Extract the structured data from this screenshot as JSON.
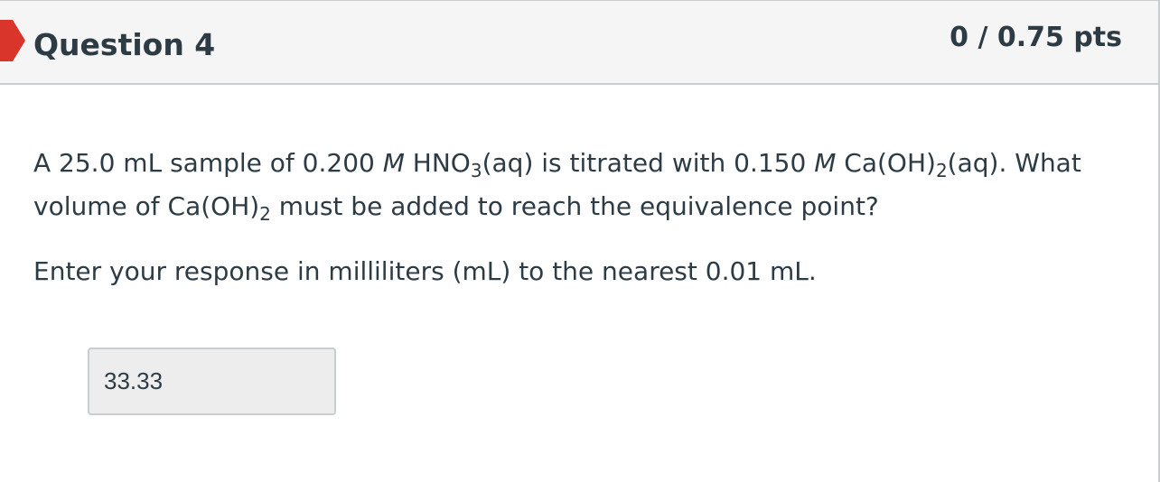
{
  "header": {
    "title": "Question 4",
    "points": "0 / 0.75 pts",
    "marker_color": "#d9352b"
  },
  "question": {
    "p1_a": "A 25.0 mL sample of 0.200 ",
    "p1_b": "M",
    "p1_c": " HNO",
    "p1_d": "3",
    "p1_e": "(aq) is titrated with 0.150 ",
    "p1_f": "M",
    "p1_g": " Ca(OH)",
    "p1_h": "2",
    "p1_i": "(aq). What volume of Ca(OH)",
    "p1_j": "2",
    "p1_k": " must be added to reach the equivalence point?",
    "p2": "Enter your response in milliliters (mL) to the nearest 0.01 mL."
  },
  "answer": {
    "value": "33.33"
  }
}
